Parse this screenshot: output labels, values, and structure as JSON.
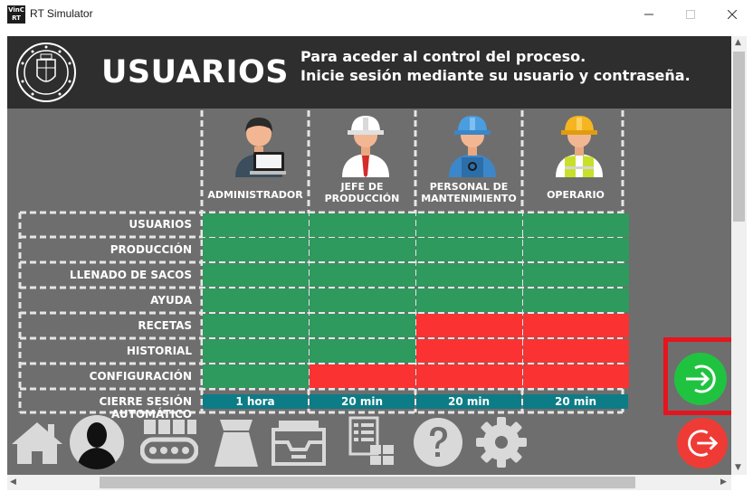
{
  "window": {
    "title": "RT Simulator",
    "icon_text_top": "VinC",
    "icon_text_bottom": "RT"
  },
  "header": {
    "title": "USUARIOS",
    "message_line1": "Para aceder al control del proceso.",
    "message_line2": "Inicie sesión mediante su usuario y contraseña.",
    "logo_icon": "university-seal-icon"
  },
  "roles": [
    {
      "label_line1": "ADMINISTRADOR",
      "label_line2": "",
      "icon": "administrator-icon",
      "timeout": "1 hora"
    },
    {
      "label_line1": "JEFE DE",
      "label_line2": "PRODUCCIÓN",
      "icon": "production-manager-icon",
      "timeout": "20 min"
    },
    {
      "label_line1": "PERSONAL DE",
      "label_line2": "MANTENIMIENTO",
      "icon": "maintenance-staff-icon",
      "timeout": "20 min"
    },
    {
      "label_line1": "OPERARIO",
      "label_line2": "",
      "icon": "operator-icon",
      "timeout": "20 min"
    }
  ],
  "permissions": {
    "rows": [
      {
        "label": "USUARIOS",
        "access": [
          true,
          true,
          true,
          true
        ]
      },
      {
        "label": "PRODUCCIÓN",
        "access": [
          true,
          true,
          true,
          true
        ]
      },
      {
        "label": "LLENADO DE SACOS",
        "access": [
          true,
          true,
          true,
          true
        ]
      },
      {
        "label": "AYUDA",
        "access": [
          true,
          true,
          true,
          true
        ]
      },
      {
        "label": "RECETAS",
        "access": [
          true,
          true,
          false,
          false
        ]
      },
      {
        "label": "HISTORIAL",
        "access": [
          true,
          true,
          false,
          false
        ]
      },
      {
        "label": "CONFIGURACIÓN",
        "access": [
          true,
          false,
          false,
          false
        ]
      }
    ],
    "timeout_label": "CIERRE SESIÓN AUTOMÁTICO",
    "allowed_color": "#2e9a5e",
    "denied_color": "#fb3232"
  },
  "toolbar": [
    {
      "name": "home-icon"
    },
    {
      "name": "user-icon"
    },
    {
      "name": "conveyor-icon"
    },
    {
      "name": "sack-icon"
    },
    {
      "name": "archive-icon"
    },
    {
      "name": "recipe-list-icon"
    },
    {
      "name": "help-icon"
    },
    {
      "name": "settings-icon"
    }
  ],
  "actions": {
    "login_icon": "login-icon",
    "logout_icon": "logout-icon"
  }
}
